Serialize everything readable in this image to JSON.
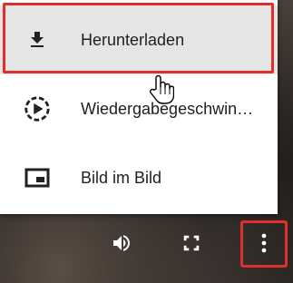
{
  "menu": {
    "items": [
      {
        "label": "Herunterladen",
        "icon": "download-icon"
      },
      {
        "label": "Wiedergabegeschwin…",
        "icon": "playback-speed-icon"
      },
      {
        "label": "Bild im Bild",
        "icon": "picture-in-picture-icon"
      }
    ]
  },
  "controls": {
    "icons": [
      "volume-icon",
      "fullscreen-icon",
      "more-options-icon"
    ]
  },
  "colors": {
    "highlight_outline": "#e0302b",
    "menu_background": "#ffffff",
    "hover_background": "#e5e5e5"
  }
}
